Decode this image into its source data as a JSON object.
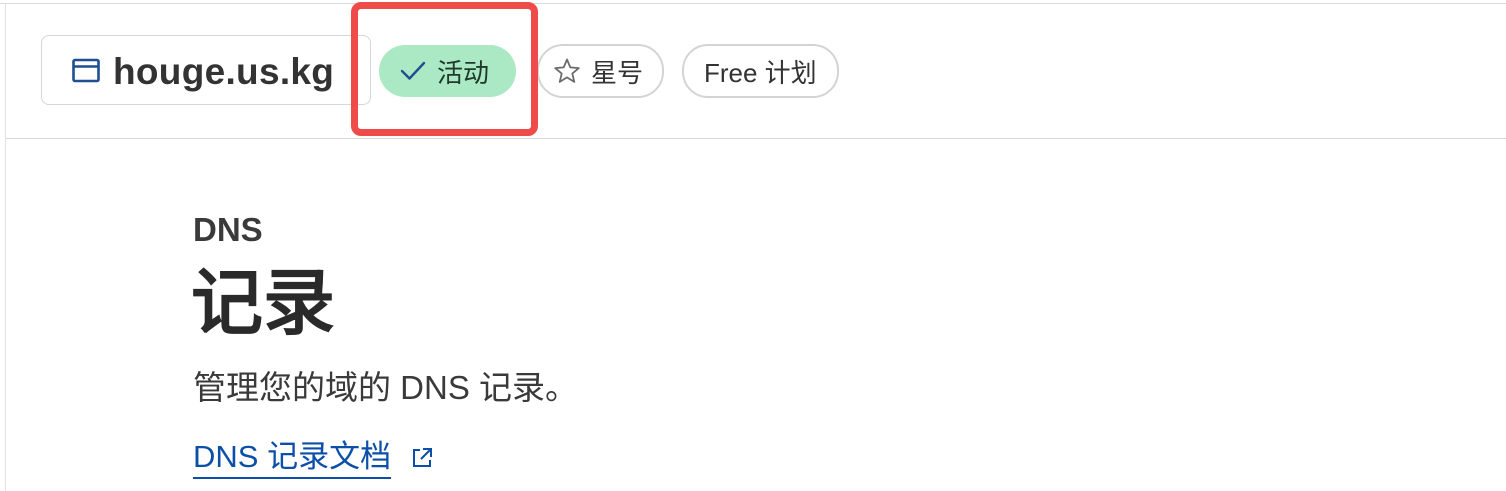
{
  "zone": {
    "domain": "houge.us.kg",
    "domain_icon": "browser-window-icon",
    "status_label": "活动",
    "status_icon": "checkmark-icon",
    "star_label": "星号",
    "star_icon": "star-icon",
    "plan_label": "Free 计划"
  },
  "page": {
    "eyebrow": "DNS",
    "title": "记录",
    "description": "管理您的域的 DNS 记录。",
    "docs_link": "DNS 记录文档",
    "docs_link_icon": "external-link-icon"
  },
  "colors": {
    "active_badge": "#abe9c5",
    "link": "#0b4fa8",
    "highlight": "#ef4b4b"
  }
}
